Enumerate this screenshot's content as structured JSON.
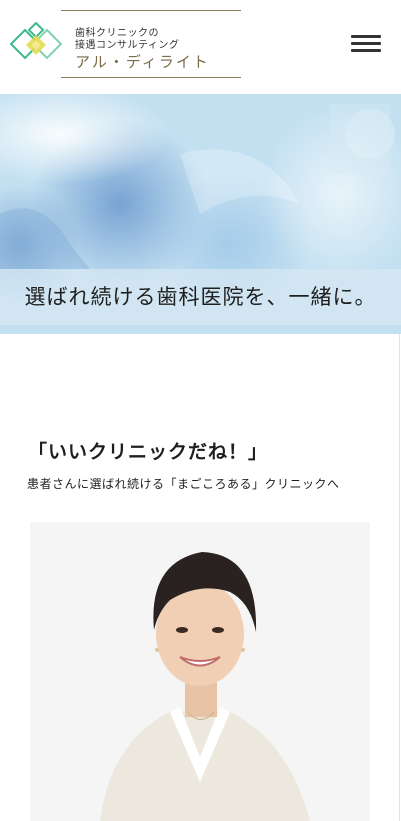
{
  "header": {
    "brand_line1": "歯科クリニックの",
    "brand_line2": "接遇コンサルティング",
    "brand_name": "アル・ディライト",
    "menu_icon": "hamburger-menu-icon"
  },
  "hero": {
    "catchphrase": "選ばれ続ける歯科医院を、一緒に。"
  },
  "intro": {
    "title": "「いいクリニックだね！」",
    "subtitle": "患者さんに選ばれ続ける「まごころある」クリニックへ"
  },
  "colors": {
    "accent_gold": "#8a7a5a",
    "logo_green": "#3fb98a",
    "logo_yellow": "#e6d94a"
  }
}
